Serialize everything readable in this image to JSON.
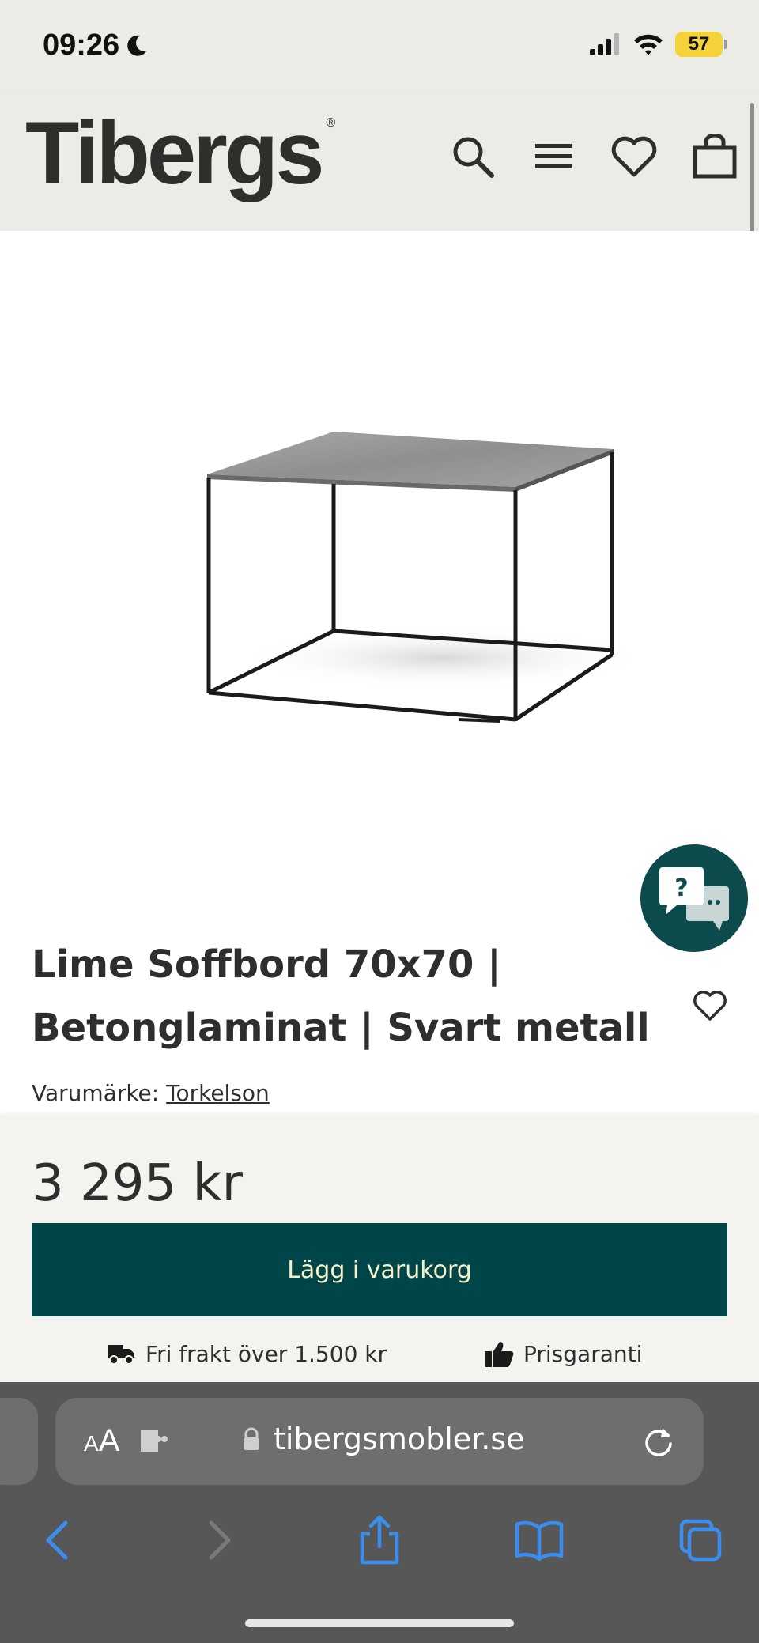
{
  "status_bar": {
    "time": "09:26",
    "battery": "57"
  },
  "header": {
    "logo": "Tibergs",
    "logo_mark": "®",
    "icons": [
      "search-icon",
      "menu-icon",
      "heart-icon",
      "cart-bag-icon"
    ]
  },
  "product": {
    "title_line1": "Lime Soffbord 70x70 |",
    "title_line2": "Betonglaminat | Svart metall",
    "brand_label": "Varumärke:",
    "brand_name": "Torkelson",
    "price": "3 295 kr",
    "add_to_cart_label": "Lägg i varukorg",
    "usp_shipping": "Fri frakt över 1.500 kr",
    "usp_price_guarantee": "Prisgaranti"
  },
  "browser": {
    "aa_label_small": "A",
    "aa_label_large": "A",
    "url": "tibergsmobler.se"
  },
  "colors": {
    "header_bg": "#ecece6",
    "accent": "#004548",
    "button_text": "#f6efc8",
    "battery": "#f4d23a"
  }
}
